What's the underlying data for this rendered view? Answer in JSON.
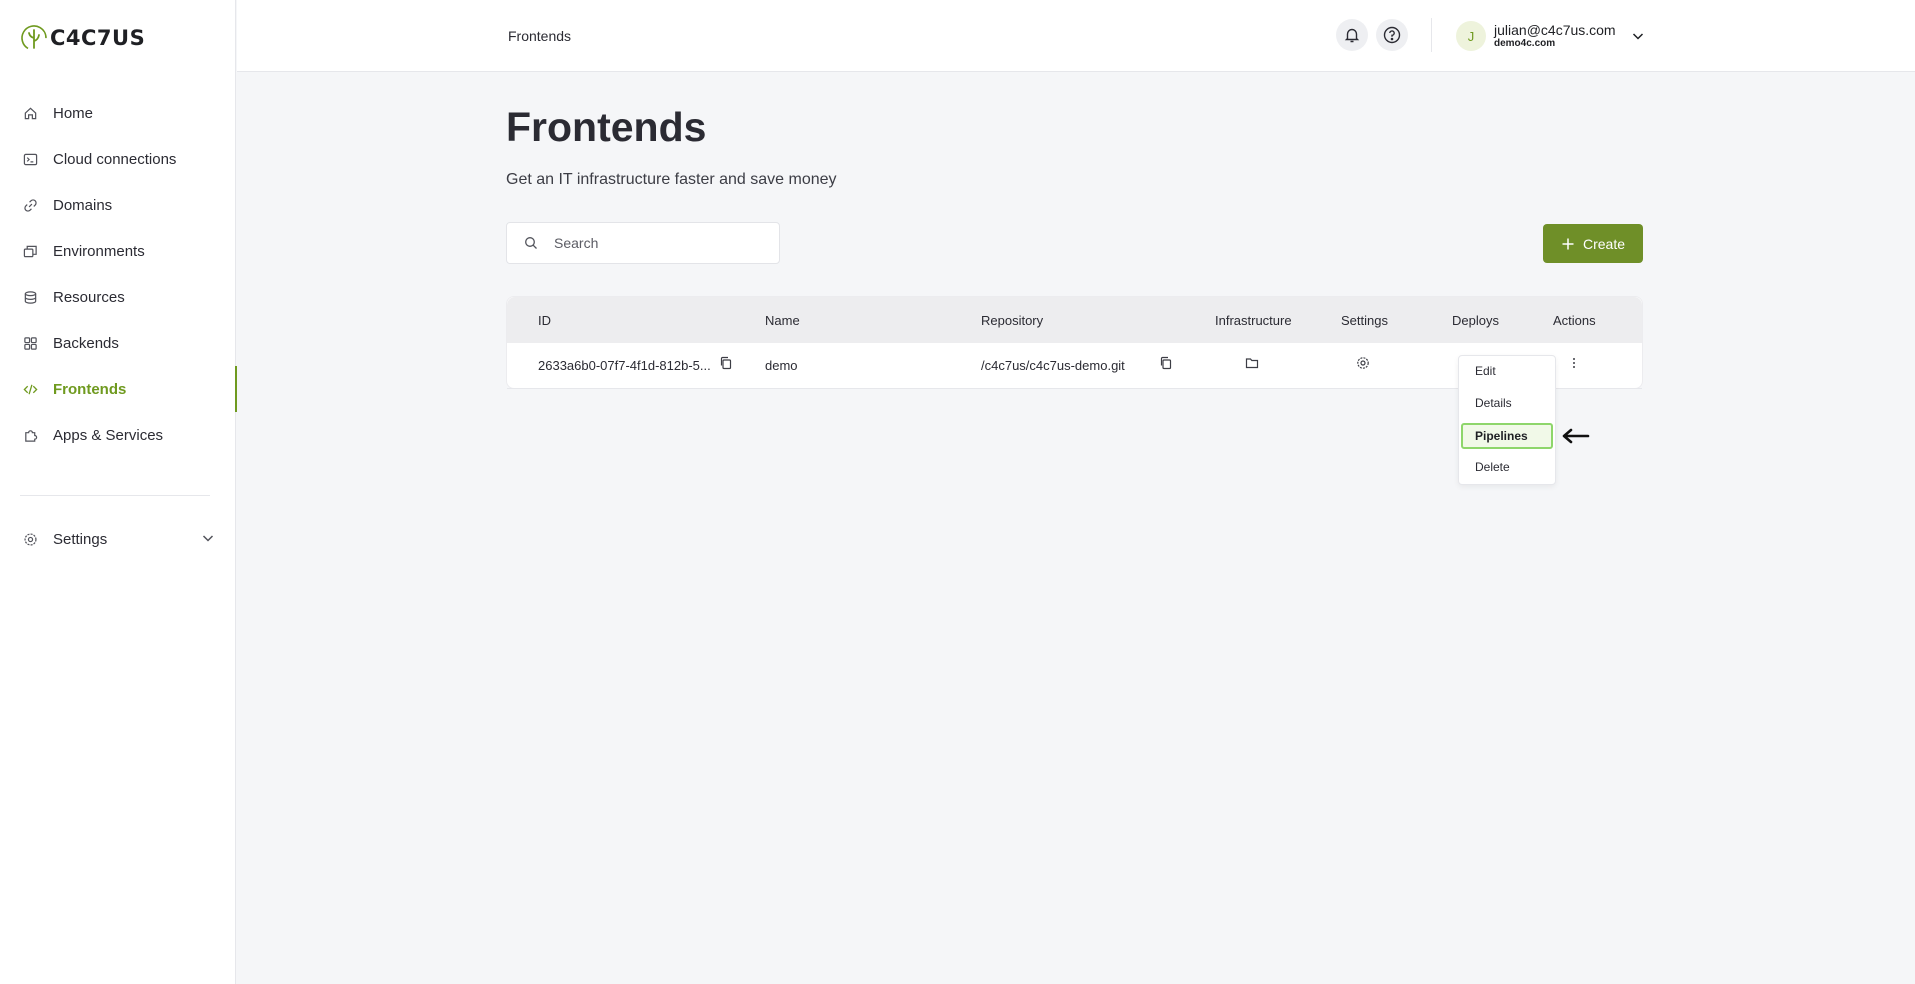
{
  "app": {
    "brand": "C4C7US",
    "brand_accent": "#6f9a1f"
  },
  "sidebar": {
    "items": [
      {
        "label": "Home",
        "icon": "home-icon"
      },
      {
        "label": "Cloud connections",
        "icon": "terminal-icon"
      },
      {
        "label": "Domains",
        "icon": "link-icon"
      },
      {
        "label": "Environments",
        "icon": "layers-icon"
      },
      {
        "label": "Resources",
        "icon": "database-icon"
      },
      {
        "label": "Backends",
        "icon": "grid-icon"
      },
      {
        "label": "Frontends",
        "icon": "code-icon",
        "active": true
      },
      {
        "label": "Apps & Services",
        "icon": "puzzle-icon"
      }
    ],
    "settings_label": "Settings"
  },
  "header": {
    "breadcrumb": "Frontends",
    "user": {
      "initial": "J",
      "email": "julian@c4c7us.com",
      "org": "demo4c.com"
    }
  },
  "main": {
    "title": "Frontends",
    "subtitle": "Get an IT infrastructure faster and save money",
    "search_placeholder": "Search",
    "create_label": "Create"
  },
  "table": {
    "columns": [
      "ID",
      "Name",
      "Repository",
      "Infrastructure",
      "Settings",
      "Deploys",
      "Actions"
    ],
    "rows": [
      {
        "id": "2633a6b0-07f7-4f1d-812b-5...",
        "name": "demo",
        "repository": "/c4c7us/c4c7us-demo.git"
      }
    ]
  },
  "actions_menu": {
    "items": [
      "Edit",
      "Details",
      "Pipelines",
      "Delete"
    ],
    "highlighted": "Pipelines"
  }
}
